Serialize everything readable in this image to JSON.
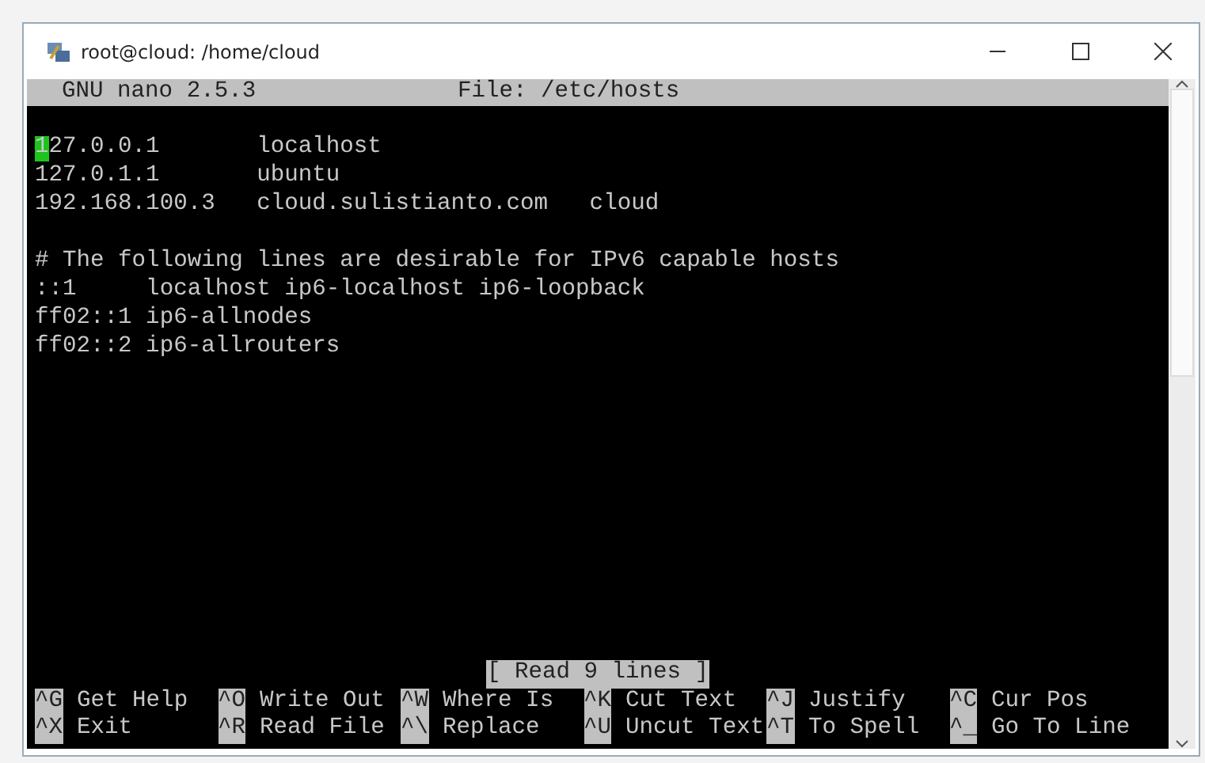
{
  "window": {
    "title": "root@cloud: /home/cloud"
  },
  "header": {
    "version": "GNU nano 2.5.3",
    "file": "File: /etc/hosts"
  },
  "lines": [
    {
      "kind": "text",
      "text": "127.0.0.1       localhost",
      "cursor": true
    },
    {
      "kind": "text",
      "text": "127.0.1.1       ubuntu",
      "cursor": false
    },
    {
      "kind": "text",
      "text": "192.168.100.3   cloud.sulistianto.com   cloud",
      "cursor": false
    },
    {
      "kind": "blank"
    },
    {
      "kind": "text",
      "text": "# The following lines are desirable for IPv6 capable hosts",
      "cursor": false
    },
    {
      "kind": "text",
      "text": "::1     localhost ip6-localhost ip6-loopback",
      "cursor": false
    },
    {
      "kind": "text",
      "text": "ff02::1 ip6-allnodes",
      "cursor": false
    },
    {
      "kind": "text",
      "text": "ff02::2 ip6-allrouters",
      "cursor": false
    }
  ],
  "status": "[ Read 9 lines ]",
  "shortcuts": [
    {
      "key": "^G",
      "label": "Get Help"
    },
    {
      "key": "^O",
      "label": "Write Out"
    },
    {
      "key": "^W",
      "label": "Where Is"
    },
    {
      "key": "^K",
      "label": "Cut Text"
    },
    {
      "key": "^J",
      "label": "Justify"
    },
    {
      "key": "^C",
      "label": "Cur Pos"
    },
    {
      "key": "^X",
      "label": "Exit"
    },
    {
      "key": "^R",
      "label": "Read File"
    },
    {
      "key": "^\\",
      "label": "Replace"
    },
    {
      "key": "^U",
      "label": "Uncut Text"
    },
    {
      "key": "^T",
      "label": "To Spell"
    },
    {
      "key": "^_",
      "label": "Go To Line"
    }
  ]
}
